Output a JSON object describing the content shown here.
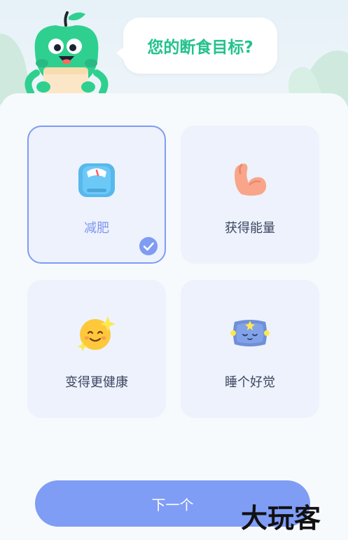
{
  "question": {
    "text": "您的断食目标?"
  },
  "goals": [
    {
      "label": "减肥",
      "icon": "scale-icon",
      "selected": true
    },
    {
      "label": "获得能量",
      "icon": "flexed-arm-icon",
      "selected": false
    },
    {
      "label": "变得更健康",
      "icon": "smiling-sun-icon",
      "selected": false
    },
    {
      "label": "睡个好觉",
      "icon": "pillow-icon",
      "selected": false
    }
  ],
  "footer": {
    "next_label": "下一个"
  },
  "watermark": {
    "text": "大玩客"
  },
  "colors": {
    "accent": "#7f9df5",
    "question_green": "#22c28c",
    "card_bg": "#edf2fd",
    "mascot_green": "#2fd08f"
  }
}
